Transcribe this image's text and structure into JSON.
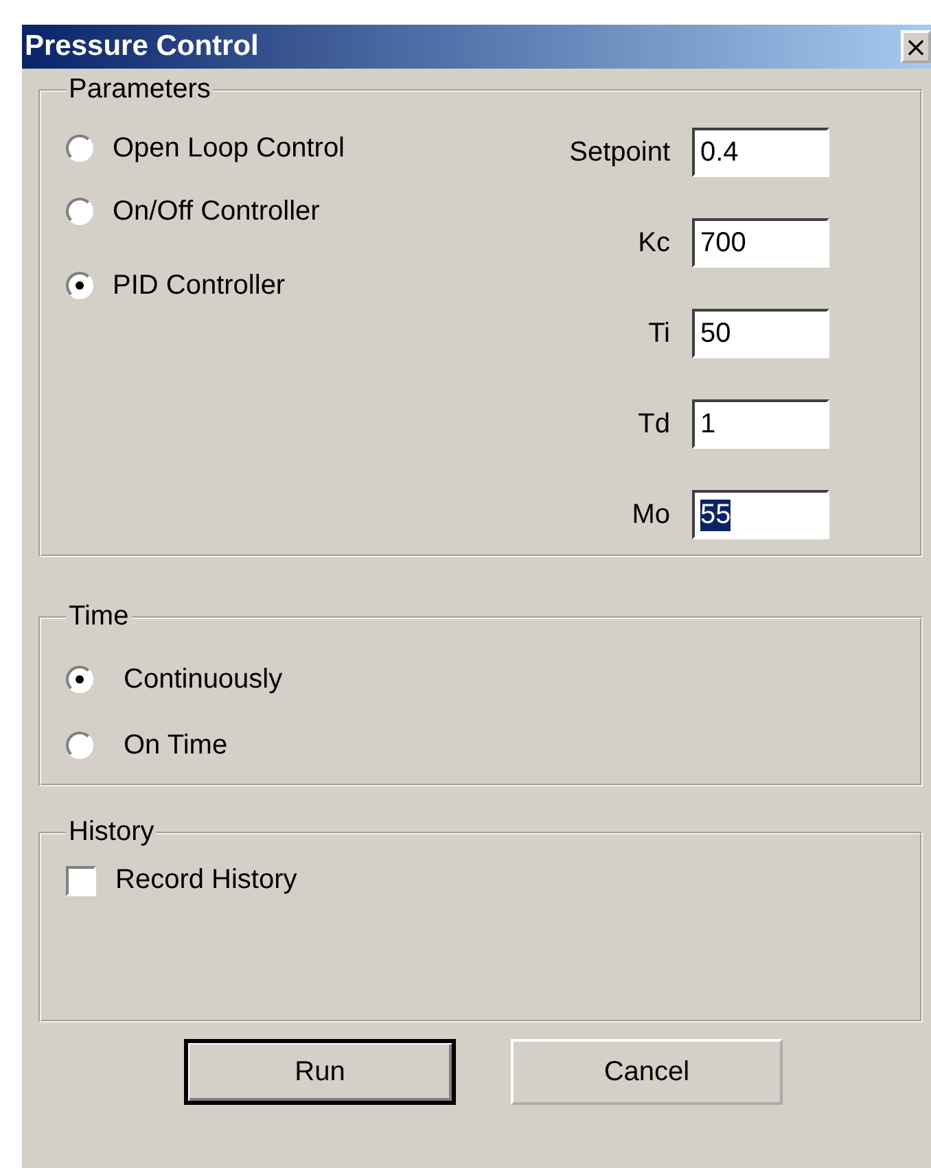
{
  "window": {
    "title": "Pressure Control",
    "close": "×"
  },
  "parameters": {
    "title": "Parameters",
    "modes": [
      {
        "label": "Open Loop Control",
        "selected": false
      },
      {
        "label": "On/Off Controller",
        "selected": false
      },
      {
        "label": "PID Controller",
        "selected": true
      }
    ],
    "fields": [
      {
        "label": "Setpoint",
        "value": "0.4",
        "text_selected": false
      },
      {
        "label": "Kc",
        "value": "700",
        "text_selected": false
      },
      {
        "label": "Ti",
        "value": "50",
        "text_selected": false
      },
      {
        "label": "Td",
        "value": "1",
        "text_selected": false
      },
      {
        "label": "Mo",
        "value": "55",
        "text_selected": true
      }
    ]
  },
  "time": {
    "title": "Time",
    "options": [
      {
        "label": "Continuously",
        "selected": true
      },
      {
        "label": "On Time",
        "selected": false
      }
    ]
  },
  "history": {
    "title": "History",
    "record": {
      "label": "Record History",
      "checked": false
    }
  },
  "buttons": [
    {
      "label": "Run",
      "default": true
    },
    {
      "label": "Cancel",
      "default": false
    }
  ]
}
